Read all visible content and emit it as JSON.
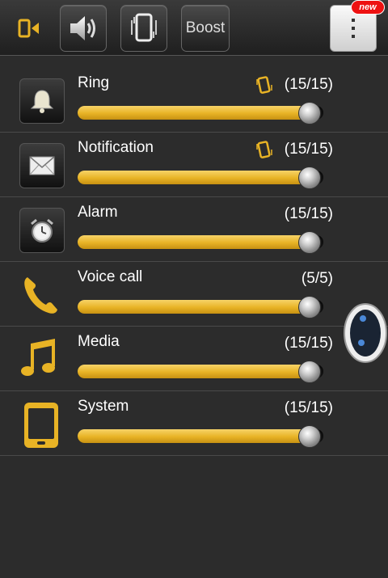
{
  "toolbar": {
    "mode_icon": "phone-speaker-icon",
    "buttons": [
      {
        "name": "sound-mode-button",
        "icon": "speaker-icon"
      },
      {
        "name": "vibrate-mode-button",
        "icon": "vibrate-icon"
      },
      {
        "name": "boost-button",
        "label": "Boost"
      }
    ],
    "menu_icon": "overflow-menu-icon",
    "new_badge": "new"
  },
  "colors": {
    "accent": "#e8b325",
    "background": "#2c2c2c",
    "badge": "#e11111"
  },
  "rows": [
    {
      "label": "Ring",
      "value": "(15/15)",
      "icon": "bell-icon",
      "level": 1.0,
      "vibrate": true
    },
    {
      "label": "Notification",
      "value": "(15/15)",
      "icon": "envelope-icon",
      "level": 1.0,
      "vibrate": true
    },
    {
      "label": "Alarm",
      "value": "(15/15)",
      "icon": "alarm-clock-icon",
      "level": 1.0,
      "vibrate": false
    },
    {
      "label": "Voice call",
      "value": "(5/5)",
      "icon": "phone-handset-icon",
      "level": 1.0,
      "vibrate": false
    },
    {
      "label": "Media",
      "value": "(15/15)",
      "icon": "music-note-icon",
      "level": 1.0,
      "vibrate": false
    },
    {
      "label": "System",
      "value": "(15/15)",
      "icon": "phone-device-icon",
      "level": 1.0,
      "vibrate": false
    }
  ]
}
